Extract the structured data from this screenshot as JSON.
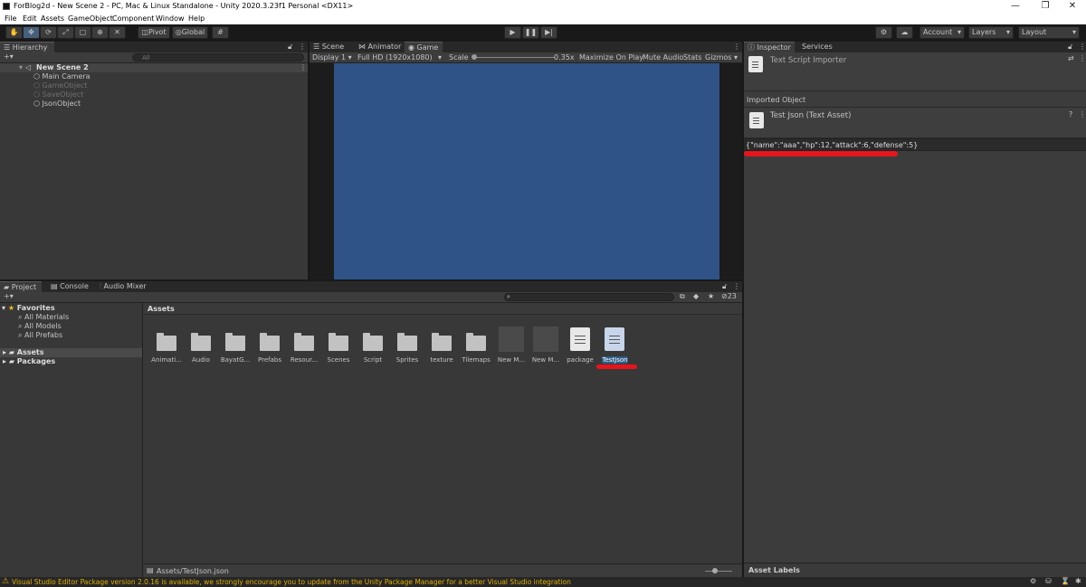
{
  "window": {
    "title": "ForBlog2d - New Scene 2 - PC, Mac & Linux Standalone - Unity 2020.3.23f1 Personal <DX11>",
    "min": "—",
    "restore": "❐",
    "close": "✕"
  },
  "menu": [
    "File",
    "Edit",
    "Assets",
    "GameObject",
    "Component",
    "Window",
    "Help"
  ],
  "toolbar": {
    "pivot": "Pivot",
    "global": "Global",
    "account": "Account",
    "layers": "Layers",
    "layout": "Layout"
  },
  "hierarchy": {
    "tab": "Hierarchy",
    "search_placeholder": "All",
    "scene": "New Scene 2",
    "items": [
      "Main Camera",
      "GameObject",
      "SaveObject",
      "JsonObject"
    ]
  },
  "scene_view": {
    "tabs": [
      "Scene",
      "Animator",
      "Game"
    ],
    "display": "Display 1",
    "resolution": "Full HD (1920x1080)",
    "scale_label": "Scale",
    "scale_value": "0.35x",
    "maximize": "Maximize On Play",
    "mute": "Mute Audio",
    "stats": "Stats",
    "gizmos": "Gizmos",
    "game_bg": "#2f5287"
  },
  "project": {
    "tabs": [
      "Project",
      "Console",
      "Audio Mixer"
    ],
    "hidden_count": "23",
    "favorites": "Favorites",
    "fav_items": [
      "All Materials",
      "All Models",
      "All Prefabs"
    ],
    "roots": [
      "Assets",
      "Packages"
    ],
    "breadcrumb": "Assets",
    "assets": [
      {
        "label": "Animati...",
        "kind": "folder"
      },
      {
        "label": "Audio",
        "kind": "folder"
      },
      {
        "label": "BayatG...",
        "kind": "folder"
      },
      {
        "label": "Prefabs",
        "kind": "folder"
      },
      {
        "label": "Resour...",
        "kind": "folder"
      },
      {
        "label": "Scenes",
        "kind": "folder"
      },
      {
        "label": "Script",
        "kind": "folder"
      },
      {
        "label": "Sprites",
        "kind": "folder"
      },
      {
        "label": "texture",
        "kind": "folder"
      },
      {
        "label": "Tilemaps",
        "kind": "folder"
      },
      {
        "label": "New M...",
        "kind": "dark"
      },
      {
        "label": "New M...",
        "kind": "dark"
      },
      {
        "label": "package",
        "kind": "doc"
      },
      {
        "label": "TestJson",
        "kind": "doc"
      }
    ],
    "path": "Assets/TestJson.json"
  },
  "inspector": {
    "tabs": [
      "Inspector",
      "Services"
    ],
    "importer": "Text Script Importer",
    "imported_object": "Imported Object",
    "asset_name": "Test Json (Text Asset)",
    "content": "{\"name\":\"aaa\",\"hp\":12,\"attack\":6,\"defense\":5}",
    "asset_labels": "Asset Labels"
  },
  "status": {
    "message": "Visual Studio Editor Package version 2.0.16 is available, we strongly encourage you to update from the Unity Package Manager for a better Visual Studio integration",
    "warn_color": "#e0b000"
  },
  "annotation_color": "#e8141c"
}
